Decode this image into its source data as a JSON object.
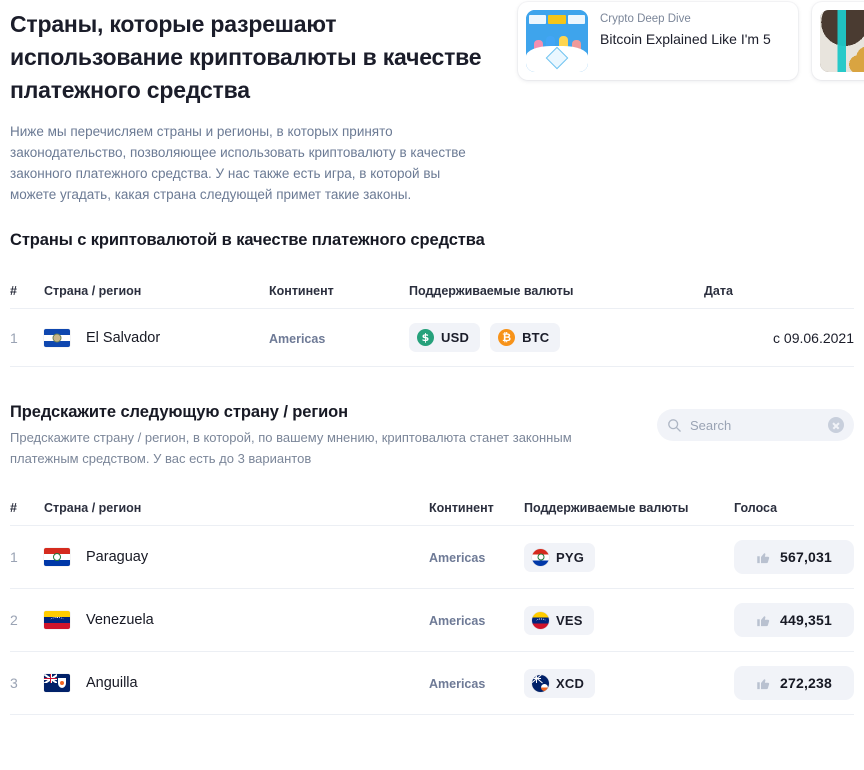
{
  "intro": {
    "title": "Страны, которые разрешают использование криптовалюты в качестве платежного средства",
    "description": "Ниже мы перечисляем страны и регионы, в которых принято законодательство, позволяющее использовать криптовалюту в качестве законного платежного средства. У нас также есть игра, в которой вы можете угадать, какая страна следующей примет такие законы."
  },
  "cards": [
    {
      "kicker": "Crypto Deep Dive",
      "title": "Bitcoin Explained Like I'm 5",
      "thumb": "bitcoin-explainer-thumbnail"
    },
    {
      "kicker": "",
      "title": "",
      "thumb": "crypto-article-thumbnail"
    }
  ],
  "legal_tender_section": {
    "title": "Страны с криптовалютой в качестве платежного средства",
    "columns": {
      "num": "#",
      "country": "Страна / регион",
      "continent": "Континент",
      "currencies": "Поддерживаемые валюты",
      "date": "Дата"
    },
    "rows": [
      {
        "num": "1",
        "flag": "el-salvador-flag",
        "country": "El Salvador",
        "continent": "Americas",
        "currencies": [
          {
            "code": "USD",
            "icon": "usd-coin-icon",
            "color": "#26a17b",
            "glyph": "$"
          },
          {
            "code": "BTC",
            "icon": "btc-coin-icon",
            "color": "#f7931a",
            "glyph": "₿"
          }
        ],
        "date": "с 09.06.2021"
      }
    ]
  },
  "predict_section": {
    "title": "Предскажите следующую страну / регион",
    "description": "Предскажите страну / регион, в которой, по вашему мнению, криптовалюта станет законным платежным средством. У вас есть до 3 вариантов",
    "search": {
      "placeholder": "Search",
      "value": "",
      "icon": "search-icon",
      "clear_icon": "clear-icon"
    },
    "columns": {
      "num": "#",
      "country": "Страна / регион",
      "continent": "Континент",
      "currencies": "Поддерживаемые валюты",
      "votes": "Голоса"
    },
    "rows": [
      {
        "num": "1",
        "flag": "paraguay-flag",
        "country": "Paraguay",
        "continent": "Americas",
        "currency": {
          "code": "PYG",
          "icon": "paraguay-currency-flag-icon"
        },
        "votes": "567,031"
      },
      {
        "num": "2",
        "flag": "venezuela-flag",
        "country": "Venezuela",
        "continent": "Americas",
        "currency": {
          "code": "VES",
          "icon": "venezuela-currency-flag-icon"
        },
        "votes": "449,351"
      },
      {
        "num": "3",
        "flag": "anguilla-flag",
        "country": "Anguilla",
        "continent": "Americas",
        "currency": {
          "code": "XCD",
          "icon": "anguilla-currency-flag-icon"
        },
        "votes": "272,238"
      }
    ]
  },
  "colors": {
    "text": "#171924",
    "muted": "#7b8699",
    "continent": "#6e7a96",
    "chip_bg": "#f1f3f8",
    "border": "#eceff4",
    "usd_green": "#26a17b",
    "btc_orange": "#f7931a"
  }
}
